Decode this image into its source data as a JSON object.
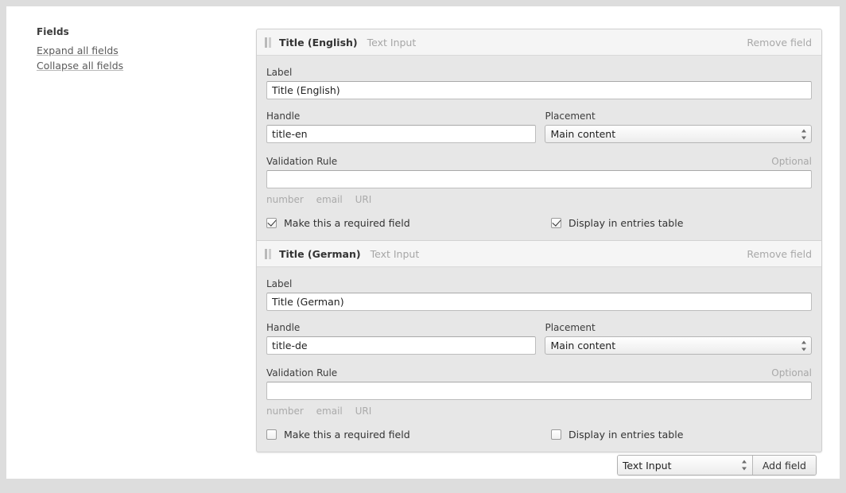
{
  "sidebar": {
    "title": "Fields",
    "expand_label": "Expand all fields",
    "collapse_label": "Collapse all fields"
  },
  "labels": {
    "label": "Label",
    "handle": "Handle",
    "placement": "Placement",
    "validation_rule": "Validation Rule",
    "optional": "Optional",
    "remove_field": "Remove field",
    "required_check": "Make this a required field",
    "entries_check": "Display in entries table"
  },
  "hints": [
    "number",
    "email",
    "URI"
  ],
  "fields": [
    {
      "title": "Title (English)",
      "type": "Text Input",
      "label_value": "Title (English)",
      "handle_value": "title-en",
      "placement_value": "Main content",
      "validation_value": "",
      "validation_placeholder": "",
      "required_checked": true,
      "entries_checked": true
    },
    {
      "title": "Title (German)",
      "type": "Text Input",
      "label_value": "Title (German)",
      "handle_value": "title-de",
      "placement_value": "Main content",
      "validation_value": "",
      "validation_placeholder": "",
      "required_checked": false,
      "entries_checked": false
    }
  ],
  "add_bar": {
    "selected_type": "Text Input",
    "button_label": "Add field"
  }
}
